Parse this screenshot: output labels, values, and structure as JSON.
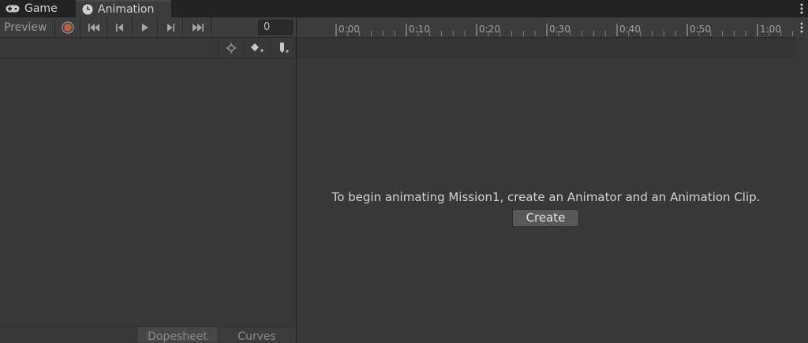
{
  "tabs": {
    "game": {
      "label": "Game",
      "icon": "gamepad-icon"
    },
    "animation": {
      "label": "Animation",
      "icon": "clock-icon"
    }
  },
  "toolbar": {
    "preview_label": "Preview",
    "frame_value": "0",
    "buttons": [
      "record-icon",
      "first-key-icon",
      "prev-key-icon",
      "play-icon",
      "next-key-icon",
      "last-key-icon"
    ]
  },
  "subbar": {
    "buttons": [
      "filter-by-selection-icon",
      "add-keyframe-icon",
      "add-event-icon"
    ]
  },
  "timeline": {
    "ticks": [
      "0:00",
      "0:10",
      "0:20",
      "0:30",
      "0:40",
      "0:50",
      "1:00"
    ]
  },
  "main": {
    "message": "To begin animating Mission1, create an Animator and an Animation Clip.",
    "create_label": "Create"
  },
  "bottom_tabs": {
    "dopesheet": "Dopesheet",
    "curves": "Curves"
  },
  "colors": {
    "record": "#c0603a",
    "background": "#383838",
    "tabbar": "#232323"
  }
}
